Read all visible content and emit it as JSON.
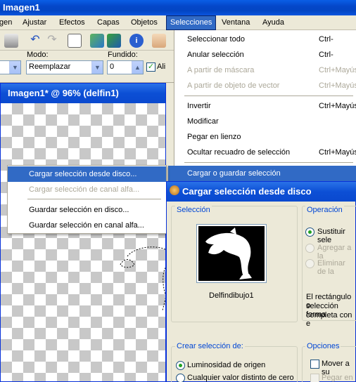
{
  "app": {
    "title": "Imagen1"
  },
  "menubar": {
    "items": [
      {
        "label": "gen"
      },
      {
        "label": "Ajustar"
      },
      {
        "label": "Efectos"
      },
      {
        "label": "Capas"
      },
      {
        "label": "Objetos"
      },
      {
        "label": "Selecciones"
      },
      {
        "label": "Ventana"
      },
      {
        "label": "Ayuda"
      }
    ]
  },
  "options": {
    "mode_label": "Modo:",
    "mode_value": "Reemplazar",
    "blend_label": "Fundido:",
    "blend_value": "0",
    "antialias_label": "Ali"
  },
  "document": {
    "title": "Imagen1* @  96% (delfin1)"
  },
  "selecciones_menu": {
    "items": [
      {
        "label": "Seleccionar todo",
        "shortcut": "Ctrl-"
      },
      {
        "label": "Anular selección",
        "shortcut": "Ctrl-"
      },
      {
        "label": "A partir de máscara",
        "shortcut": "Ctrl+Mayús-"
      },
      {
        "label": "A partir de objeto de vector",
        "shortcut": "Ctrl+Mayús-"
      },
      {
        "label": "Invertir",
        "shortcut": "Ctrl+Mayús"
      },
      {
        "label": "Modificar",
        "shortcut": ""
      },
      {
        "label": "Pegar en lienzo",
        "shortcut": ""
      },
      {
        "label": "Ocultar recuadro de selección",
        "shortcut": "Ctrl+Mayús-"
      },
      {
        "label": "Cargar o guardar selección",
        "shortcut": ""
      }
    ]
  },
  "submenu": {
    "items": [
      {
        "label": "Cargar selección desde disco..."
      },
      {
        "label": "Cargar selección de canal alfa..."
      },
      {
        "label": "Guardar selección en disco..."
      },
      {
        "label": "Guardar selección en canal alfa..."
      }
    ]
  },
  "dialog": {
    "title": "Cargar selección desde disco",
    "seleccion_label": "Selección",
    "thumbnail_name": "Delfindibujo1",
    "operacion_label": "Operación",
    "op_replace": "Sustituir sele",
    "op_add": "Agregar a la",
    "op_remove": "Eliminar de la",
    "info_text_1": "El rectángulo o",
    "info_text_2": "selección forma",
    "info_text_3": "completa con e",
    "crear_label": "Crear selección de:",
    "crear_opt1": "Luminosidad de origen",
    "crear_opt2": "Cualquier valor distinto de cero",
    "opciones_label": "Opciones",
    "opt_move": "Mover a su",
    "opt_paste": "Pegar en l"
  }
}
